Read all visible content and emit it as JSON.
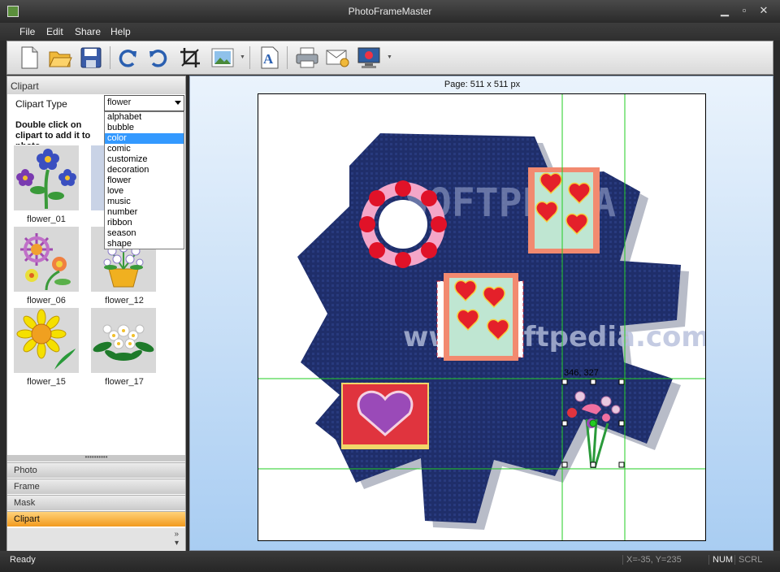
{
  "window": {
    "title": "PhotoFrameMaster"
  },
  "menu": [
    "File",
    "Edit",
    "Share",
    "Help"
  ],
  "toolbar": {
    "icons": [
      "new-icon",
      "open-icon",
      "save-icon",
      "redo-icon",
      "undo-icon",
      "crop-icon",
      "picture-icon",
      "text-icon",
      "print-icon",
      "email-icon",
      "screen-icon"
    ]
  },
  "left_panel": {
    "header": "Clipart",
    "clipart_type_label": "Clipart Type",
    "clipart_type_value": "flower",
    "hint": "Double click on clipart to add it to photo",
    "dropdown_options": [
      "alphabet",
      "bubble",
      "color",
      "comic",
      "customize",
      "decoration",
      "flower",
      "love",
      "music",
      "number",
      "ribbon",
      "season",
      "shape"
    ],
    "dropdown_selected": "color",
    "thumbnails": [
      {
        "label": "flower_01"
      },
      {
        "label": ""
      },
      {
        "label": "flower_06"
      },
      {
        "label": "flower_12"
      },
      {
        "label": "flower_15"
      },
      {
        "label": "flower_17"
      }
    ],
    "nav": [
      {
        "label": "Photo",
        "active": false
      },
      {
        "label": "Frame",
        "active": false
      },
      {
        "label": "Mask",
        "active": false
      },
      {
        "label": "Clipart",
        "active": true
      }
    ]
  },
  "canvas": {
    "page_label": "Page: 511 x 511 px",
    "selection_readout": "346, 327",
    "watermark": "SOFTPEDIA",
    "watermark_url": "www.softpedia.com"
  },
  "status": {
    "text": "Ready",
    "coords": "X=-35, Y=235",
    "num": "NUM",
    "scrl": "SCRL"
  },
  "colors": {
    "accent": "#f29a1e",
    "guide": "#22cc22",
    "frame_blue": "#1f2e6a",
    "selection": "#3399ff"
  }
}
